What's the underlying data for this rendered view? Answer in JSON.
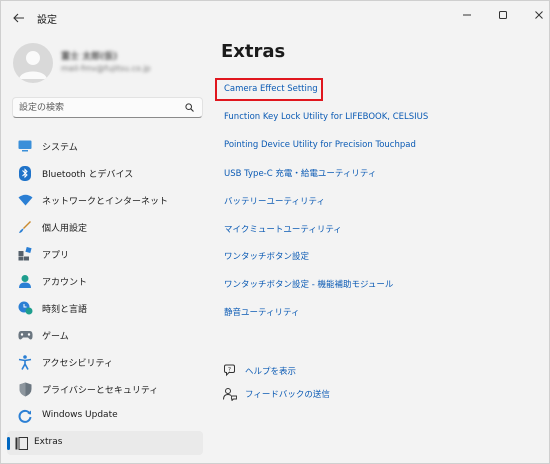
{
  "window": {
    "title": "設定"
  },
  "user": {
    "name": "富士 太郎(仮)",
    "email": "mail-fmv@fujitsu.co.jp"
  },
  "search": {
    "placeholder": "設定の検索"
  },
  "sidebar": {
    "items": [
      {
        "label": "システム",
        "icon": "system-monitor-icon"
      },
      {
        "label": "Bluetooth とデバイス",
        "icon": "bluetooth-icon"
      },
      {
        "label": "ネットワークとインターネット",
        "icon": "wifi-icon"
      },
      {
        "label": "個人用設定",
        "icon": "paintbrush-icon"
      },
      {
        "label": "アプリ",
        "icon": "apps-icon"
      },
      {
        "label": "アカウント",
        "icon": "account-icon"
      },
      {
        "label": "時刻と言語",
        "icon": "time-language-icon"
      },
      {
        "label": "ゲーム",
        "icon": "gamepad-icon"
      },
      {
        "label": "アクセシビリティ",
        "icon": "accessibility-icon"
      },
      {
        "label": "プライバシーとセキュリティ",
        "icon": "shield-icon"
      },
      {
        "label": "Windows Update",
        "icon": "windows-update-icon"
      },
      {
        "label": "Extras",
        "icon": "extras-icon",
        "selected": true
      }
    ]
  },
  "main": {
    "title": "Extras",
    "links": [
      "Camera Effect Setting",
      "Function Key Lock Utility for LIFEBOOK, CELSIUS",
      "Pointing Device Utility for Precision Touchpad",
      "USB Type-C 充電・給電ユーティリティ",
      "バッテリーユーティリティ",
      "マイクミュートユーティリティ",
      "ワンタッチボタン設定",
      "ワンタッチボタン設定 - 機能補助モジュール",
      "静音ユーティリティ"
    ],
    "help": [
      {
        "label": "ヘルプを表示",
        "icon": "help-icon"
      },
      {
        "label": "フィードバックの送信",
        "icon": "feedback-icon"
      }
    ]
  },
  "colors": {
    "accent": "#0067c0",
    "link": "#0a5ab4",
    "highlight": "#e0161e"
  }
}
